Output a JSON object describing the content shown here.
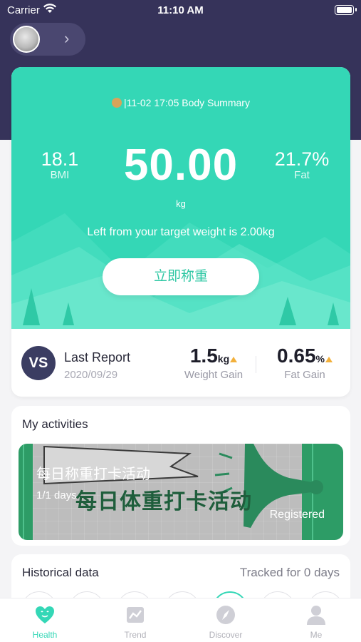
{
  "status_bar": {
    "carrier": "Carrier",
    "time": "11:10 AM"
  },
  "header": {
    "chevron": "›"
  },
  "summary": {
    "title": "|11-02 17:05 Body Summary",
    "bmi_value": "18.1",
    "bmi_label": "BMI",
    "weight_value": "50.00",
    "weight_unit": "kg",
    "fat_value": "21.7%",
    "fat_label": "Fat",
    "target_text": "Left from your target weight is 2.00kg",
    "weigh_button": "立即称重"
  },
  "report": {
    "vs_label": "VS",
    "title": "Last Report",
    "date": "2020/09/29",
    "weight_gain_value": "1.5",
    "weight_gain_unit": "kg",
    "weight_gain_label": "Weight Gain",
    "fat_gain_value": "0.65",
    "fat_gain_unit": "%",
    "fat_gain_label": "Fat Gain"
  },
  "activities": {
    "heading": "My activities",
    "banner_title_small": "每日称重打卡活动",
    "banner_title_big": "每日体重打卡活动",
    "banner_days": "1/1 days",
    "banner_status": "Registered"
  },
  "history": {
    "heading": "Historical data",
    "tracked": "Tracked for 0 days"
  },
  "tabs": [
    {
      "label": "Health",
      "icon": "health-heart-icon",
      "active": true
    },
    {
      "label": "Trend",
      "icon": "trend-chart-icon",
      "active": false
    },
    {
      "label": "Discover",
      "icon": "compass-icon",
      "active": false
    },
    {
      "label": "Me",
      "icon": "person-icon",
      "active": false
    }
  ],
  "colors": {
    "header_bg": "#36335a",
    "accent": "#34d7b6",
    "vs_bg": "#3b3d62",
    "up_arrow": "#f2b03b"
  }
}
